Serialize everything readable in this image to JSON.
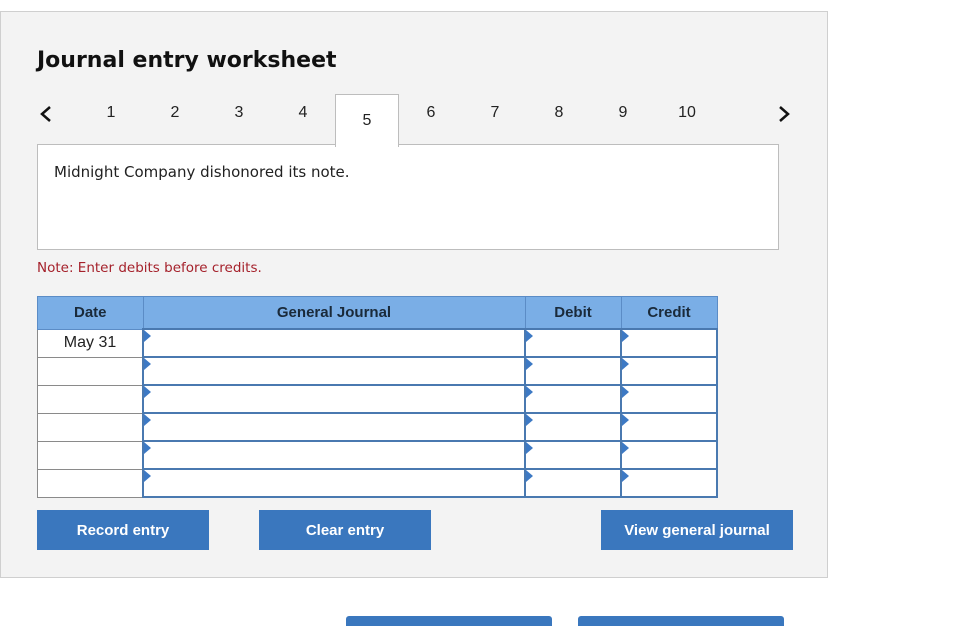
{
  "worksheet": {
    "title": "Journal entry worksheet",
    "tabs": [
      "1",
      "2",
      "3",
      "4",
      "5",
      "6",
      "7",
      "8",
      "9",
      "10"
    ],
    "active_tab": "5",
    "prev_icon": "chevron-left-icon",
    "next_icon": "chevron-right-icon",
    "description": "Midnight Company dishonored its note.",
    "note": "Note: Enter debits before credits."
  },
  "journal": {
    "headers": {
      "date": "Date",
      "account": "General Journal",
      "debit": "Debit",
      "credit": "Credit"
    },
    "rows": [
      {
        "date": "May 31",
        "account": "",
        "debit": "",
        "credit": ""
      },
      {
        "date": "",
        "account": "",
        "debit": "",
        "credit": ""
      },
      {
        "date": "",
        "account": "",
        "debit": "",
        "credit": ""
      },
      {
        "date": "",
        "account": "",
        "debit": "",
        "credit": ""
      },
      {
        "date": "",
        "account": "",
        "debit": "",
        "credit": ""
      },
      {
        "date": "",
        "account": "",
        "debit": "",
        "credit": ""
      }
    ]
  },
  "buttons": {
    "record": "Record entry",
    "clear": "Clear entry",
    "view": "View general journal"
  },
  "colors": {
    "accent": "#3a77be",
    "header": "#7aaee6",
    "note": "#a5212b",
    "panel": "#f3f3f3"
  }
}
